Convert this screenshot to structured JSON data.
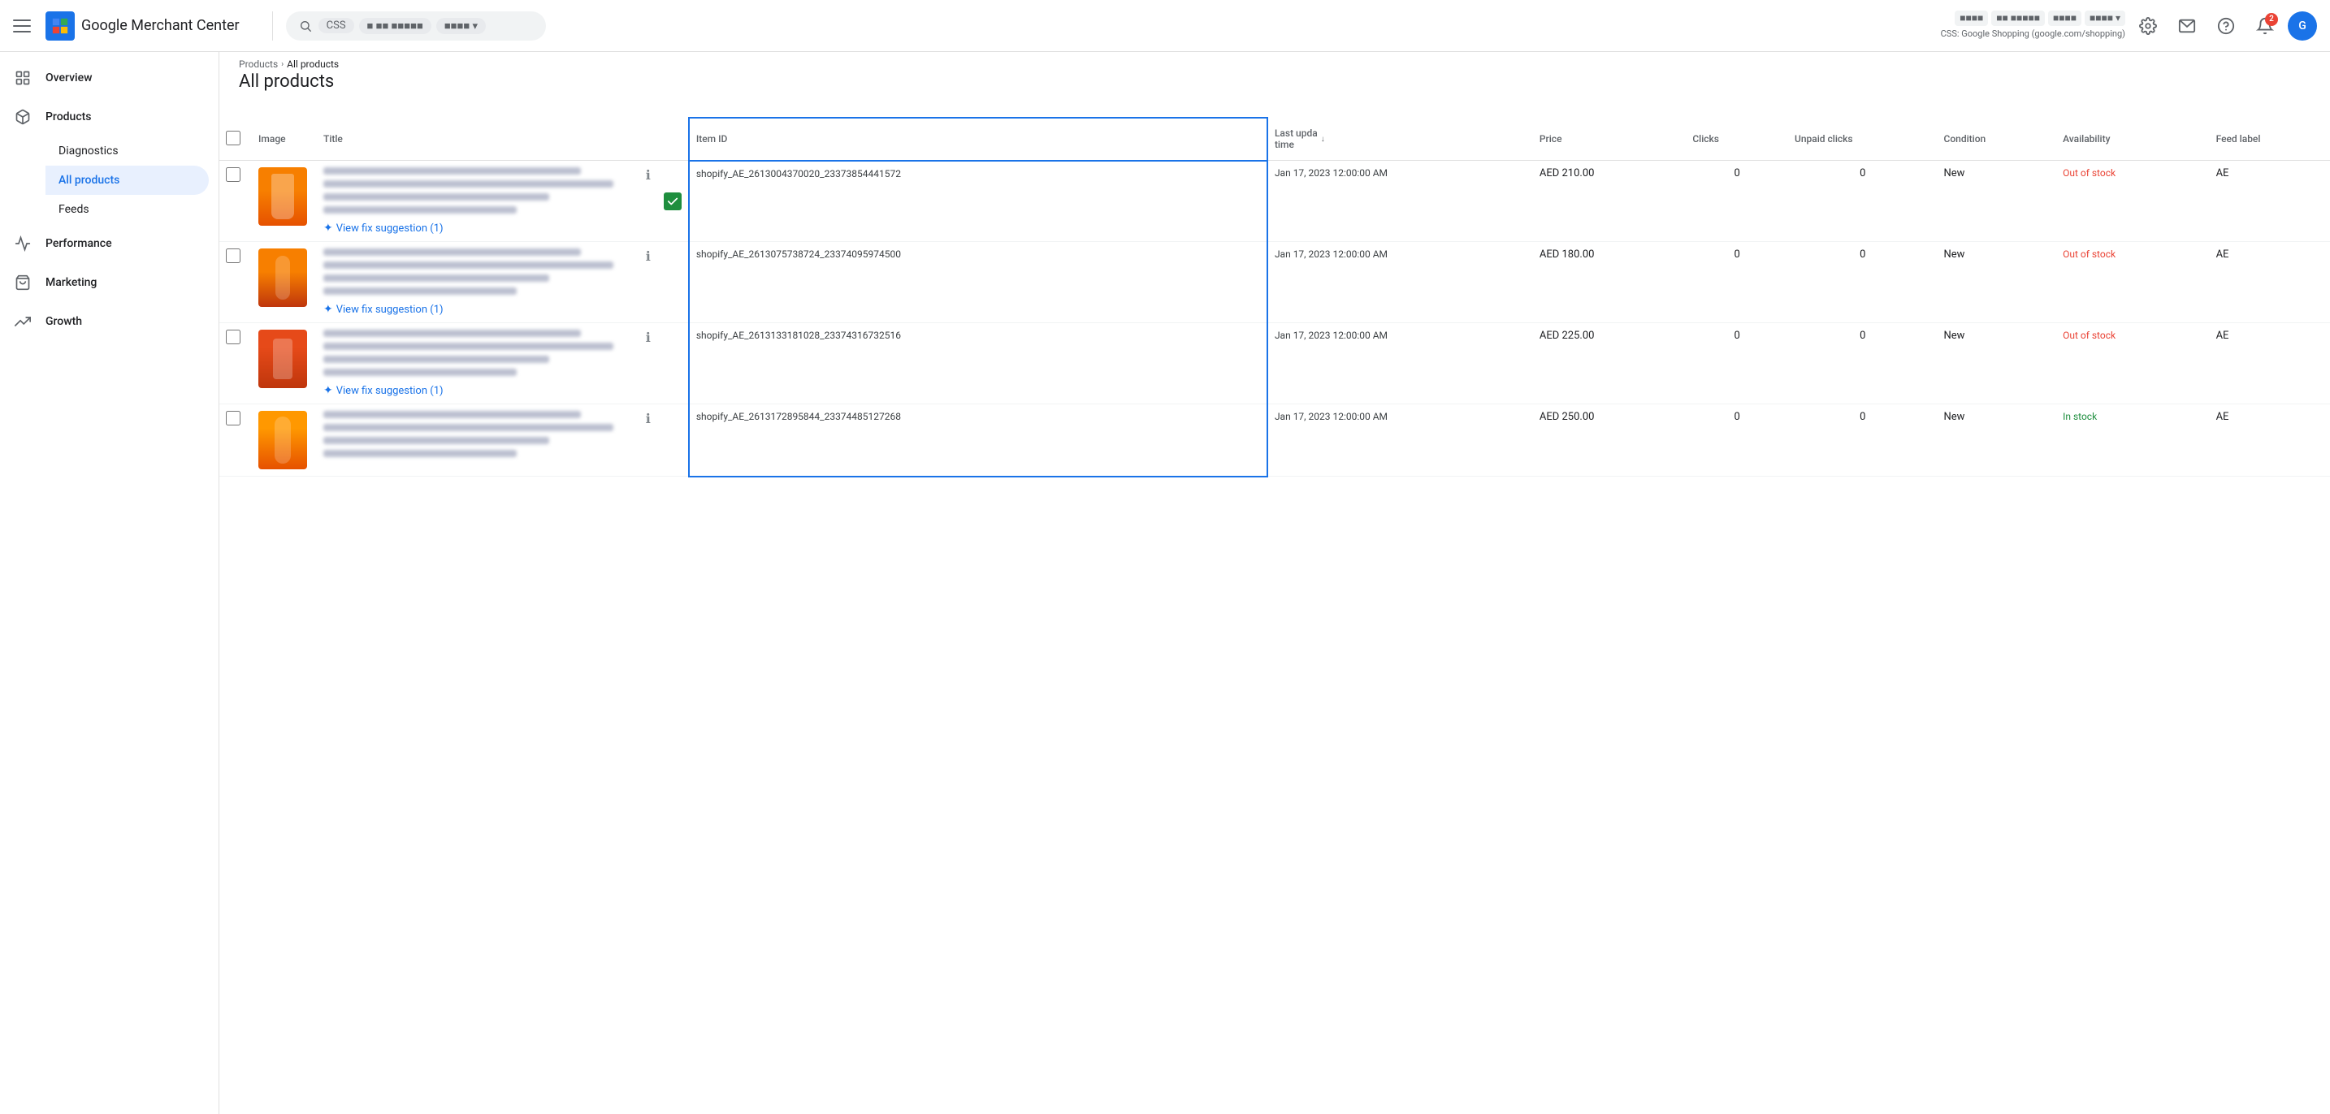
{
  "header": {
    "menu_icon": "menu-icon",
    "logo_text": "Google Merchant Center",
    "search_placeholder": "Search",
    "search_pills": [
      "CSS",
      "Store",
      "AE"
    ],
    "notification_count": "2",
    "store_info": "CSS: Google Shopping (google.com/shopping)"
  },
  "breadcrumb": {
    "parent": "Products",
    "arrow": "›",
    "current": "All products"
  },
  "sidebar": {
    "items": [
      {
        "id": "overview",
        "label": "Overview",
        "icon": "grid-icon"
      },
      {
        "id": "products",
        "label": "Products",
        "icon": "box-icon",
        "expanded": true
      },
      {
        "id": "performance",
        "label": "Performance",
        "icon": "chart-icon"
      },
      {
        "id": "marketing",
        "label": "Marketing",
        "icon": "tag-icon"
      },
      {
        "id": "growth",
        "label": "Growth",
        "icon": "trending-icon"
      }
    ],
    "sub_items": [
      {
        "id": "diagnostics",
        "label": "Diagnostics"
      },
      {
        "id": "all-products",
        "label": "All products",
        "active": true
      },
      {
        "id": "feeds",
        "label": "Feeds"
      }
    ]
  },
  "table": {
    "columns": [
      {
        "id": "checkbox",
        "label": ""
      },
      {
        "id": "image",
        "label": "Image"
      },
      {
        "id": "title",
        "label": "Title"
      },
      {
        "id": "check",
        "label": ""
      },
      {
        "id": "itemid",
        "label": "Item ID"
      },
      {
        "id": "updated",
        "label": "Last upda time"
      },
      {
        "id": "price",
        "label": "Price"
      },
      {
        "id": "clicks",
        "label": "Clicks"
      },
      {
        "id": "unpaid",
        "label": "Unpaid clicks"
      },
      {
        "id": "condition",
        "label": "Condition"
      },
      {
        "id": "availability",
        "label": "Availability"
      },
      {
        "id": "feed",
        "label": "Feed label"
      }
    ],
    "rows": [
      {
        "id": "row1",
        "item_id": "shopify_AE_2613004370020_23373854441572",
        "updated": "Jan 17, 2023 12:00:00 AM",
        "price": "AED 210.00",
        "clicks": "0",
        "unpaid_clicks": "0",
        "condition": "New",
        "availability": "Out of stock",
        "feed_label": "AE",
        "has_fix": true,
        "fix_label": "View fix suggestion (1)",
        "img_class": "prod-img-1"
      },
      {
        "id": "row2",
        "item_id": "shopify_AE_2613075738724_23374095974500",
        "updated": "Jan 17, 2023 12:00:00 AM",
        "price": "AED 180.00",
        "clicks": "0",
        "unpaid_clicks": "0",
        "condition": "New",
        "availability": "Out of stock",
        "feed_label": "AE",
        "has_fix": true,
        "fix_label": "View fix suggestion (1)",
        "img_class": "prod-img-2"
      },
      {
        "id": "row3",
        "item_id": "shopify_AE_2613133181028_23374316732516",
        "updated": "Jan 17, 2023 12:00:00 AM",
        "price": "AED 225.00",
        "clicks": "0",
        "unpaid_clicks": "0",
        "condition": "New",
        "availability": "Out of stock",
        "feed_label": "AE",
        "has_fix": true,
        "fix_label": "View fix suggestion (1)",
        "img_class": "prod-img-3"
      },
      {
        "id": "row4",
        "item_id": "shopify_AE_2613172895844_23374485127268",
        "updated": "Jan 17, 2023 12:00:00 AM",
        "price": "AED 250.00",
        "clicks": "0",
        "unpaid_clicks": "0",
        "condition": "New",
        "availability": "In stock",
        "feed_label": "AE",
        "has_fix": false,
        "fix_label": "",
        "img_class": "prod-img-4"
      }
    ]
  }
}
